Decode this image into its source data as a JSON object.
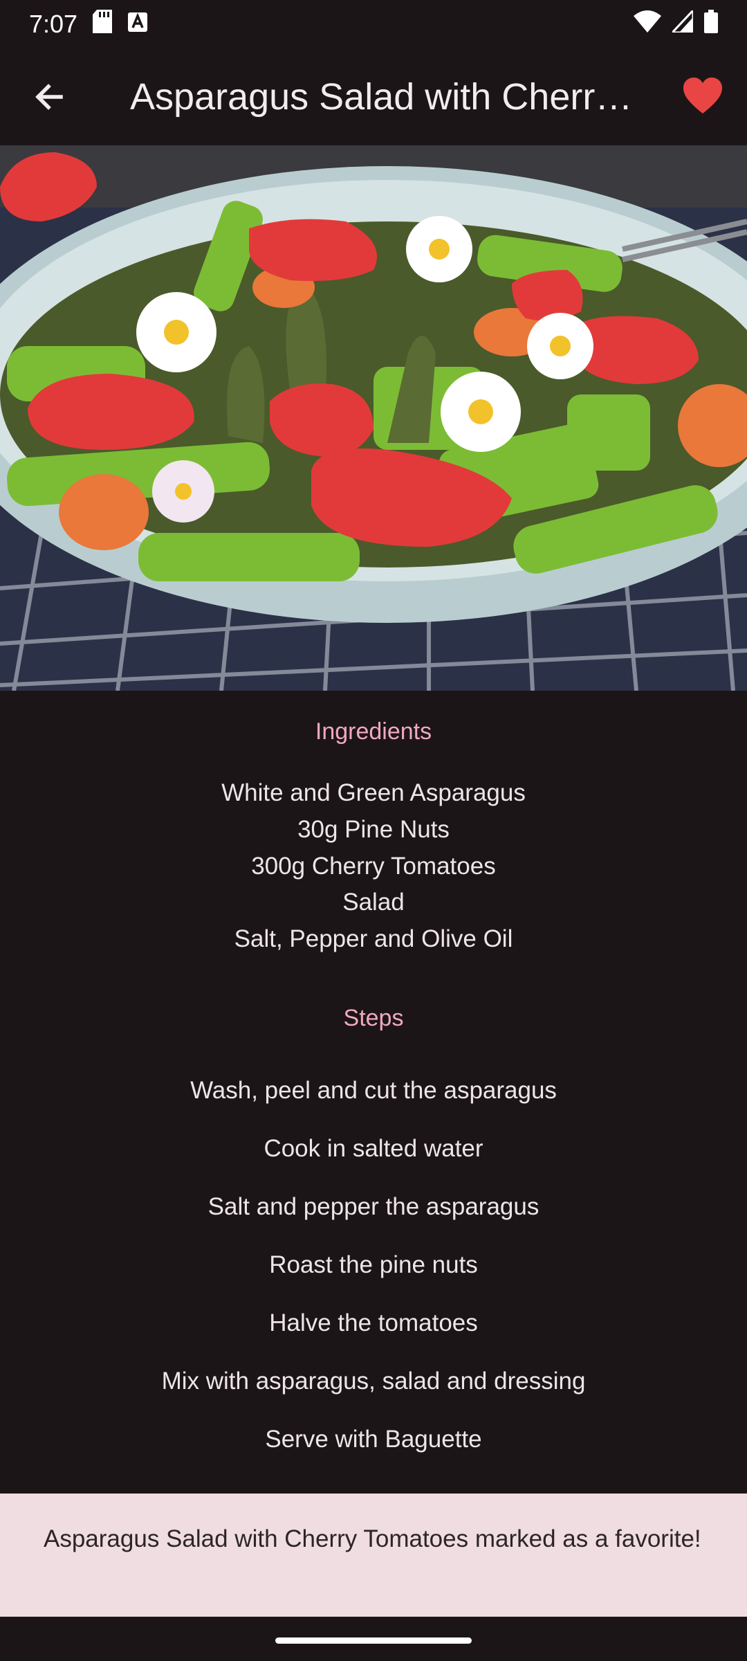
{
  "status_bar": {
    "time": "7:07"
  },
  "app_bar": {
    "title": "Asparagus Salad with Cherry Tomatoes"
  },
  "ingredients": {
    "heading": "Ingredients",
    "items": [
      "White and Green Asparagus",
      "30g Pine Nuts",
      "300g Cherry Tomatoes",
      "Salad",
      "Salt, Pepper and Olive Oil"
    ]
  },
  "steps": {
    "heading": "Steps",
    "items": [
      "Wash, peel and cut the asparagus",
      "Cook in salted water",
      "Salt and pepper the asparagus",
      "Roast the pine nuts",
      "Halve the tomatoes",
      "Mix with asparagus, salad and dressing",
      "Serve with Baguette"
    ]
  },
  "snackbar": {
    "message": "Asparagus Salad with Cherry Tomatoes marked as a favorite!"
  },
  "colors": {
    "accent": "#f0a9bf",
    "favorite": "#e94545",
    "background": "#1c1517",
    "snackbar": "#efdde1"
  }
}
